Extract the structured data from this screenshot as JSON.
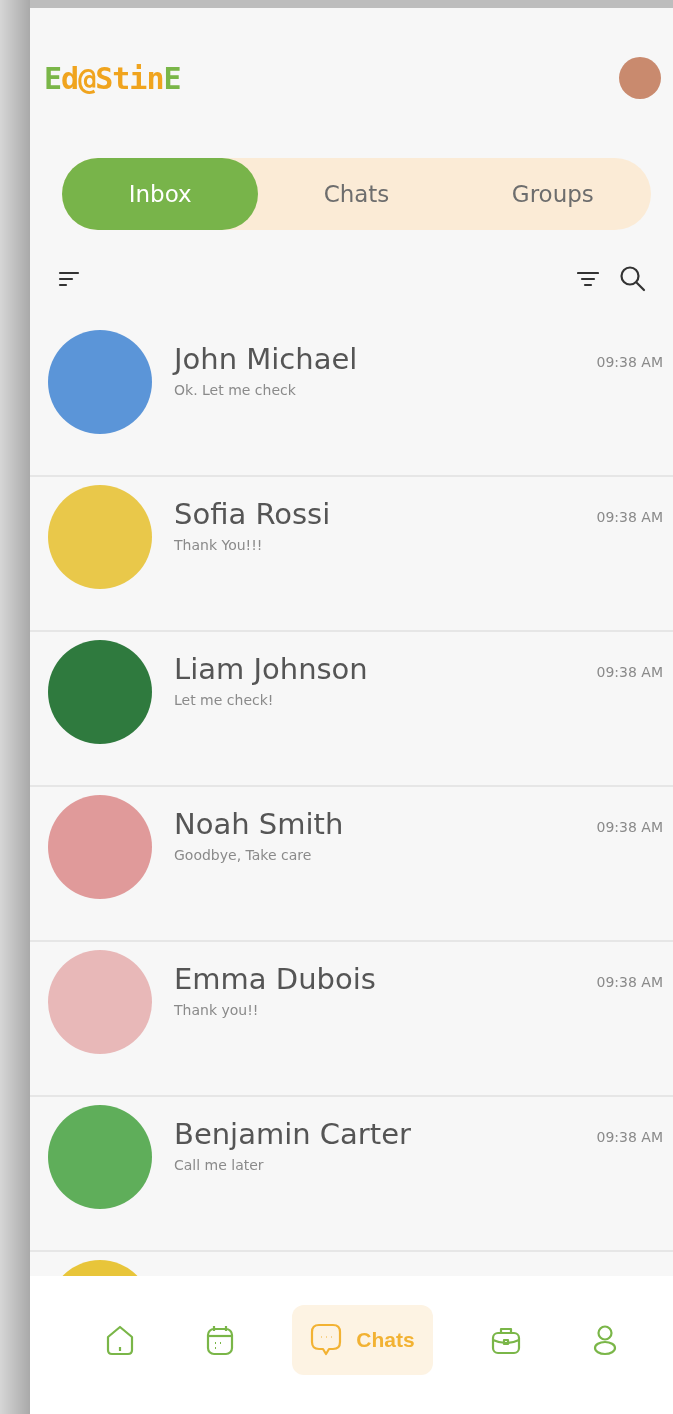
{
  "header": {
    "logo": "Ed@StinE"
  },
  "tabs": [
    {
      "label": "Inbox",
      "selected": true
    },
    {
      "label": "Chats",
      "selected": false
    },
    {
      "label": "Groups",
      "selected": false
    }
  ],
  "chats": [
    {
      "name": "John Michael",
      "message": "Ok. Let me check",
      "time": "09:38 AM",
      "color": "#5b95d8"
    },
    {
      "name": "Sofia Rossi",
      "message": "Thank You!!!",
      "time": "09:38 AM",
      "color": "#e9c84a"
    },
    {
      "name": "Liam Johnson",
      "message": "Let me check!",
      "time": "09:38 AM",
      "color": "#2f7a3e"
    },
    {
      "name": "Noah Smith",
      "message": "Goodbye, Take care",
      "time": "09:38 AM",
      "color": "#e09a9a"
    },
    {
      "name": "Emma Dubois",
      "message": "Thank you!!",
      "time": "09:38 AM",
      "color": "#e8b8b8"
    },
    {
      "name": "Benjamin Carter",
      "message": "Call me later",
      "time": "09:38 AM",
      "color": "#5fae5a"
    }
  ],
  "partial_row": {
    "color": "#e8c53a"
  },
  "bottom_nav": [
    {
      "kind": "home",
      "selected": false
    },
    {
      "kind": "calendar",
      "selected": false
    },
    {
      "kind": "chat",
      "selected": true,
      "label": "Chats"
    },
    {
      "kind": "briefcase",
      "selected": false
    },
    {
      "kind": "person",
      "selected": false
    }
  ]
}
